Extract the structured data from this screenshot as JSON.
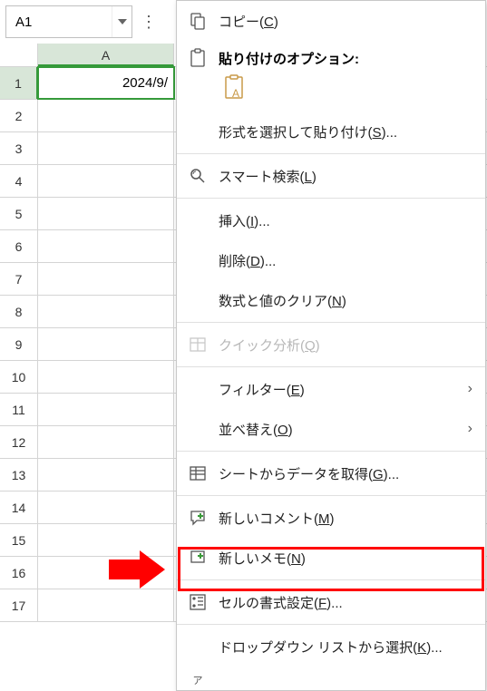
{
  "name_box": {
    "value": "A1"
  },
  "columns": [
    "A"
  ],
  "rows_count": 17,
  "cell_a1": "2024/9/",
  "menu": {
    "copy": "コピー(",
    "copy_key": "C",
    "paste_header": "貼り付けのオプション:",
    "paste_special": "形式を選択して貼り付け(",
    "paste_special_key": "S",
    "smart_lookup": "スマート検索(",
    "smart_lookup_key": "L",
    "insert": "挿入(",
    "insert_key": "I",
    "delete": "削除(",
    "delete_key": "D",
    "clear": "数式と値のクリア(",
    "clear_key": "N",
    "quick_analysis": "クイック分析(",
    "quick_analysis_key": "Q",
    "filter": "フィルター(",
    "filter_key": "E",
    "sort": "並べ替え(",
    "sort_key": "O",
    "get_data": "シートからデータを取得(",
    "get_data_key": "G",
    "new_comment": "新しいコメント(",
    "new_comment_key": "M",
    "new_note": "新しいメモ(",
    "new_note_key": "N",
    "format_cells": "セルの書式設定(",
    "format_cells_key": "F",
    "dropdown_select": "ドロップダウン リストから選択(",
    "dropdown_select_key": "K",
    "ellipsis": ")...",
    "close_paren": ")"
  }
}
